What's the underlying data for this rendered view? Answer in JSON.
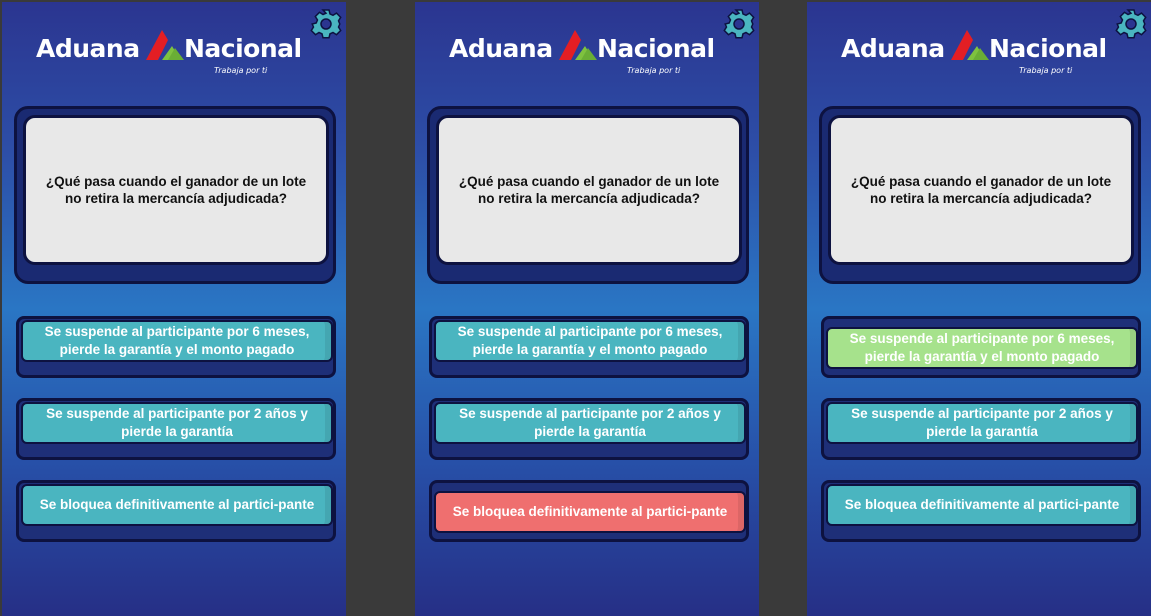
{
  "brand": {
    "word1": "Aduana",
    "word2": "Nacional",
    "slogan": "Trabaja por ti",
    "colors": {
      "red": "#e31e24",
      "green": "#7ec23f",
      "white": "#ffffff"
    }
  },
  "settings_icon": "gear-icon",
  "theme": {
    "accent": "#49b3be",
    "correct": "#a6e28c",
    "wrong": "#ef6f6f"
  },
  "panels": [
    {
      "question": "¿Qué pasa cuando el ganador de un lote no retira la mercancía adjudicada?",
      "answers": [
        {
          "text": "Se suspende al participante por 6 meses, pierde la garantía y el monto pagado",
          "state": "default"
        },
        {
          "text": "Se suspende al participante por 2 años y pierde la garantía",
          "state": "default"
        },
        {
          "text": "Se bloquea definitivamente al partici-pante",
          "state": "default"
        }
      ]
    },
    {
      "question": "¿Qué pasa cuando el ganador de un lote no retira la mercancía adjudicada?",
      "answers": [
        {
          "text": "Se suspende al participante por 6 meses, pierde la garantía y el monto pagado",
          "state": "default"
        },
        {
          "text": "Se suspende al participante por 2 años y pierde la garantía",
          "state": "default"
        },
        {
          "text": "Se bloquea definitivamente al partici-pante",
          "state": "wrong"
        }
      ]
    },
    {
      "question": "¿Qué pasa cuando el ganador de un lote no retira la mercancía adjudicada?",
      "answers": [
        {
          "text": "Se suspende al participante por 6 meses, pierde la garantía y el monto pagado",
          "state": "correct"
        },
        {
          "text": "Se suspende al participante por 2 años y pierde la garantía",
          "state": "default"
        },
        {
          "text": "Se bloquea definitivamente al partici-pante",
          "state": "default"
        }
      ]
    }
  ]
}
